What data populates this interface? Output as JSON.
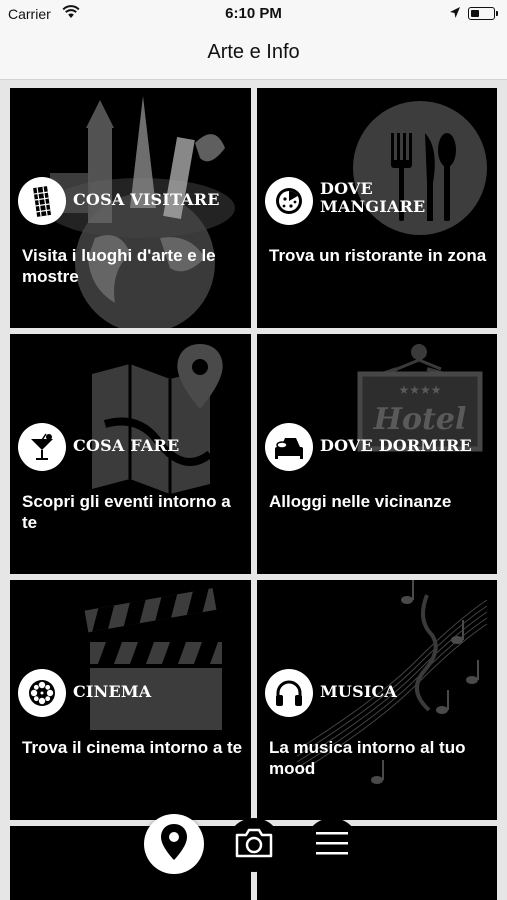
{
  "status_bar": {
    "carrier": "Carrier",
    "time": "6:10 PM",
    "icons": [
      "wifi-icon",
      "location-arrow-icon",
      "battery-icon"
    ]
  },
  "nav": {
    "title": "Arte e Info"
  },
  "tiles": [
    {
      "category": "COSA VISITARE",
      "description": "Visita i luoghi d'arte e le mostre",
      "icon": "leaning-tower-icon",
      "background": "world-landmarks-globe"
    },
    {
      "category": "DOVE MANGIARE",
      "description": "Trova un ristorante in zona",
      "icon": "pizza-icon",
      "background": "fork-knife-spoon"
    },
    {
      "category": "COSA FARE",
      "description": "Scopri gli eventi intorno a te",
      "icon": "cocktail-icon",
      "background": "map-pin"
    },
    {
      "category": "DOVE DORMIRE",
      "description": "Alloggi nelle vicinanze",
      "icon": "bed-icon",
      "background": "hotel-sign",
      "background_text": "Hotel",
      "background_stars": "★★★★"
    },
    {
      "category": "CINEMA",
      "description": "Trova il cinema intorno a te",
      "icon": "film-reel-icon",
      "background": "clapperboard"
    },
    {
      "category": "MUSICA",
      "description": "La musica intorno al tuo mood",
      "icon": "headphones-icon",
      "background": "music-notes"
    }
  ],
  "bottom_bar": {
    "buttons": [
      "map-pin-icon",
      "camera-icon",
      "menu-icon"
    ]
  },
  "colors": {
    "tile_background": "#000000",
    "tile_text": "#ffffff",
    "grid_gap": "#e6e6e6",
    "bar_background": "#f7f7f7"
  }
}
